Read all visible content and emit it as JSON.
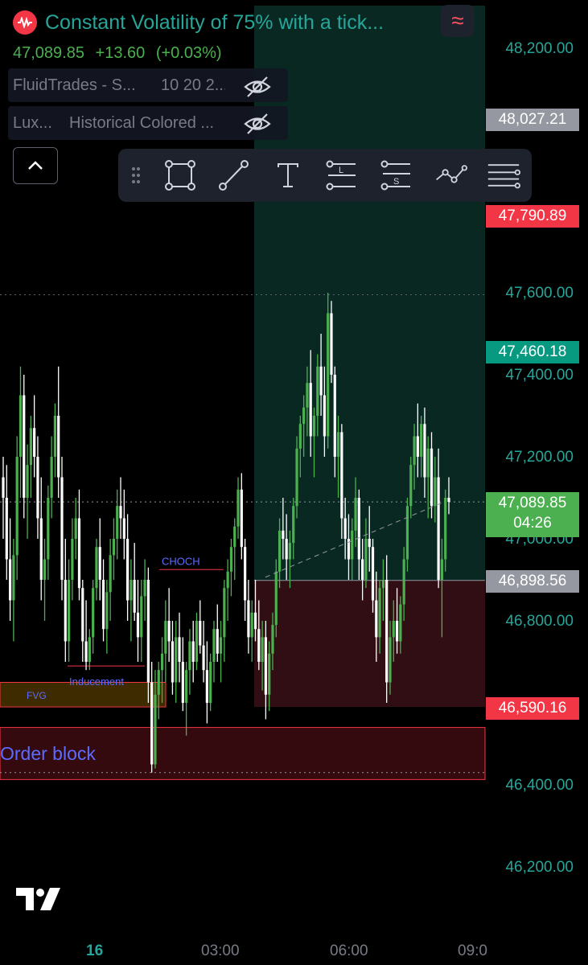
{
  "header": {
    "title": "Constant Volatility of 75% with a tick...",
    "last_price": "47,089.85",
    "change": "+13.60",
    "change_pct": "(+0.03%)"
  },
  "indicators": [
    {
      "name": "FluidTrades - S...",
      "params": "10 20 2..."
    },
    {
      "name": "Lux...",
      "params": "Historical Colored ..."
    }
  ],
  "price_axis": [
    "48,200.00",
    "47,600.00",
    "47,400.00",
    "47,200.00",
    "47,000.00",
    "46,800.00",
    "46,400.00",
    "46,200.00"
  ],
  "price_labels": [
    {
      "text": "48,027.21",
      "color": "#9598a1",
      "kind": "gray"
    },
    {
      "text": "47,790.89",
      "color": "#f23645",
      "kind": "red"
    },
    {
      "text": "47,460.18",
      "color": "#089981",
      "kind": "teal"
    },
    {
      "text": "47,089.85",
      "sub": "04:26",
      "color": "#4caf50",
      "kind": "green"
    },
    {
      "text": "46,898.56",
      "color": "#9598a1",
      "kind": "gray"
    },
    {
      "text": "46,590.16",
      "color": "#f23645",
      "kind": "red"
    }
  ],
  "time_axis": [
    "16",
    "03:00",
    "06:00",
    "09:0"
  ],
  "annotations": {
    "choch": "CHOCH",
    "inducement": "Inducement",
    "fvg": "FVG",
    "order_block": "Order block"
  },
  "toolbar": [
    "drag-handle-icon",
    "rectangle-tool-icon",
    "trend-line-tool-icon",
    "text-tool-icon",
    "long-position-tool-icon",
    "short-position-tool-icon",
    "path-tool-icon",
    "more-lines-tool-icon"
  ],
  "colors": {
    "up": "#4caf50",
    "down": "#ffffff",
    "accent": "#26a69a",
    "bear": "#f23645"
  },
  "chart_data": {
    "type": "candlestick",
    "ylim": [
      46100,
      48300
    ],
    "x_ticks": [
      "16",
      "03:00",
      "06:00",
      "09:0"
    ],
    "zones": [
      {
        "name": "Order block",
        "low": 46413,
        "high": 46540
      },
      {
        "name": "FVG",
        "low": 46590,
        "high": 46650
      },
      {
        "name": "short-position-target",
        "low": 46590,
        "high": 46898.56
      },
      {
        "name": "short-position-stop",
        "low": 46898.56,
        "high": 48300
      }
    ],
    "levels": [
      {
        "name": "high-dotted",
        "value": 47595
      },
      {
        "name": "last-price-dotted",
        "value": 47089.85
      },
      {
        "name": "low-dotted",
        "value": 46430
      },
      {
        "name": "CHOCH",
        "value": 46925
      },
      {
        "name": "Inducement",
        "value": 46690
      }
    ],
    "candles": [
      [
        47150,
        47200,
        47000,
        47100
      ],
      [
        47100,
        47180,
        46900,
        46950
      ],
      [
        46950,
        47050,
        46800,
        46850
      ],
      [
        46850,
        47000,
        46750,
        46960
      ],
      [
        46960,
        47250,
        46900,
        47200
      ],
      [
        47200,
        47420,
        47100,
        47350
      ],
      [
        47350,
        47400,
        47050,
        47100
      ],
      [
        47100,
        47230,
        47000,
        47180
      ],
      [
        47180,
        47300,
        47100,
        47270
      ],
      [
        47270,
        47350,
        47150,
        47200
      ],
      [
        47200,
        47250,
        47000,
        47050
      ],
      [
        47050,
        47150,
        46850,
        46900
      ],
      [
        46900,
        47000,
        46800,
        46950
      ],
      [
        46950,
        47130,
        46900,
        47100
      ],
      [
        47100,
        47250,
        47050,
        47200
      ],
      [
        47200,
        47330,
        47150,
        47300
      ],
      [
        47300,
        47420,
        47100,
        47150
      ],
      [
        47150,
        47200,
        46850,
        46900
      ],
      [
        46900,
        47000,
        46700,
        46750
      ],
      [
        46750,
        46950,
        46700,
        46900
      ],
      [
        46900,
        47050,
        46850,
        47000
      ],
      [
        47000,
        47100,
        46950,
        47050
      ],
      [
        47050,
        47120,
        46850,
        46880
      ],
      [
        46880,
        46900,
        46700,
        46750
      ],
      [
        46750,
        46850,
        46680,
        46700
      ],
      [
        46700,
        46780,
        46680,
        46760
      ],
      [
        46760,
        46900,
        46720,
        46880
      ],
      [
        46880,
        47000,
        46850,
        46980
      ],
      [
        46980,
        47050,
        46850,
        46900
      ],
      [
        46900,
        46950,
        46750,
        46780
      ],
      [
        46780,
        46900,
        46720,
        46870
      ],
      [
        46870,
        47000,
        46800,
        46960
      ],
      [
        46960,
        47050,
        46900,
        47000
      ],
      [
        47000,
        47120,
        46950,
        47080
      ],
      [
        47080,
        47150,
        47000,
        47050
      ],
      [
        47050,
        47120,
        46950,
        47000
      ],
      [
        47000,
        47060,
        46800,
        46850
      ],
      [
        46850,
        46950,
        46750,
        46900
      ],
      [
        46900,
        46990,
        46800,
        46820
      ],
      [
        46820,
        46900,
        46700,
        46760
      ],
      [
        46760,
        46900,
        46700,
        46860
      ],
      [
        46860,
        46950,
        46800,
        46900
      ],
      [
        46900,
        46930,
        46600,
        46650
      ],
      [
        46650,
        46700,
        46430,
        46450
      ],
      [
        46450,
        46680,
        46440,
        46620
      ],
      [
        46620,
        46700,
        46560,
        46680
      ],
      [
        46680,
        46760,
        46600,
        46720
      ],
      [
        46720,
        46850,
        46650,
        46800
      ],
      [
        46800,
        46880,
        46700,
        46750
      ],
      [
        46750,
        46800,
        46620,
        46650
      ],
      [
        46650,
        46800,
        46600,
        46760
      ],
      [
        46760,
        46820,
        46650,
        46700
      ],
      [
        46700,
        46760,
        46580,
        46600
      ],
      [
        46600,
        46700,
        46520,
        46680
      ],
      [
        46680,
        46780,
        46620,
        46750
      ],
      [
        46750,
        46800,
        46650,
        46700
      ],
      [
        46700,
        46820,
        46680,
        46800
      ],
      [
        46800,
        46850,
        46720,
        46740
      ],
      [
        46740,
        46800,
        46650,
        46680
      ],
      [
        46680,
        46750,
        46550,
        46600
      ],
      [
        46600,
        46720,
        46580,
        46700
      ],
      [
        46700,
        46800,
        46650,
        46780
      ],
      [
        46780,
        46840,
        46700,
        46720
      ],
      [
        46720,
        46800,
        46650,
        46760
      ],
      [
        46760,
        46900,
        46700,
        46880
      ],
      [
        46880,
        46950,
        46800,
        46920
      ],
      [
        46920,
        47000,
        46860,
        46980
      ],
      [
        46980,
        47050,
        46900,
        47030
      ],
      [
        47030,
        47150,
        47000,
        47120
      ],
      [
        47120,
        47160,
        46950,
        46980
      ],
      [
        46980,
        47000,
        46800,
        46850
      ],
      [
        46850,
        46900,
        46720,
        46760
      ],
      [
        46760,
        46850,
        46700,
        46820
      ],
      [
        46820,
        46900,
        46750,
        46780
      ],
      [
        46780,
        46850,
        46680,
        46700
      ],
      [
        46700,
        46800,
        46630,
        46760
      ],
      [
        46760,
        46800,
        46560,
        46620
      ],
      [
        46620,
        46750,
        46580,
        46720
      ],
      [
        46720,
        46820,
        46680,
        46790
      ],
      [
        46790,
        46950,
        46760,
        46920
      ],
      [
        46920,
        47050,
        46880,
        47020
      ],
      [
        47020,
        47100,
        46950,
        47000
      ],
      [
        47000,
        47060,
        46900,
        46950
      ],
      [
        46950,
        47020,
        46880,
        46990
      ],
      [
        46990,
        47100,
        46950,
        47080
      ],
      [
        47080,
        47250,
        47050,
        47220
      ],
      [
        47220,
        47300,
        47150,
        47280
      ],
      [
        47280,
        47350,
        47200,
        47320
      ],
      [
        47320,
        47420,
        47250,
        47380
      ],
      [
        47380,
        47460,
        47200,
        47250
      ],
      [
        47250,
        47320,
        47150,
        47300
      ],
      [
        47300,
        47450,
        47250,
        47420
      ],
      [
        47420,
        47500,
        47300,
        47350
      ],
      [
        47350,
        47420,
        47200,
        47250
      ],
      [
        47250,
        47600,
        47220,
        47550
      ],
      [
        47550,
        47580,
        47380,
        47400
      ],
      [
        47400,
        47420,
        47150,
        47200
      ],
      [
        47200,
        47300,
        47100,
        47260
      ],
      [
        47260,
        47280,
        47000,
        47050
      ],
      [
        47050,
        47100,
        46950,
        47000
      ],
      [
        47000,
        47060,
        46900,
        46950
      ],
      [
        46950,
        47050,
        46900,
        47020
      ],
      [
        47020,
        47150,
        46980,
        47100
      ],
      [
        47100,
        47120,
        46900,
        46950
      ],
      [
        46950,
        47000,
        46850,
        46900
      ],
      [
        46900,
        47050,
        46880,
        47000
      ],
      [
        47000,
        47080,
        46920,
        46980
      ],
      [
        46980,
        47000,
        46820,
        46850
      ],
      [
        46850,
        46920,
        46700,
        46760
      ],
      [
        46760,
        46900,
        46720,
        46880
      ],
      [
        46880,
        46950,
        46800,
        46900
      ],
      [
        46900,
        46960,
        46600,
        46650
      ],
      [
        46650,
        46800,
        46620,
        46760
      ],
      [
        46760,
        46850,
        46700,
        46800
      ],
      [
        46800,
        46880,
        46720,
        46750
      ],
      [
        46750,
        46860,
        46720,
        46840
      ],
      [
        46840,
        46980,
        46800,
        46950
      ],
      [
        46950,
        47100,
        46920,
        47080
      ],
      [
        47080,
        47200,
        47050,
        47180
      ],
      [
        47180,
        47280,
        47120,
        47250
      ],
      [
        47250,
        47330,
        47150,
        47200
      ],
      [
        47200,
        47300,
        47150,
        47280
      ],
      [
        47280,
        47320,
        47100,
        47150
      ],
      [
        47150,
        47250,
        47050,
        47220
      ],
      [
        47220,
        47260,
        47050,
        47080
      ],
      [
        47080,
        47200,
        47040,
        47150
      ],
      [
        47150,
        47220,
        46880,
        46900
      ],
      [
        46900,
        47000,
        46760,
        46950
      ],
      [
        46950,
        47120,
        46920,
        47100
      ],
      [
        47100,
        47150,
        47060,
        47090
      ]
    ]
  }
}
